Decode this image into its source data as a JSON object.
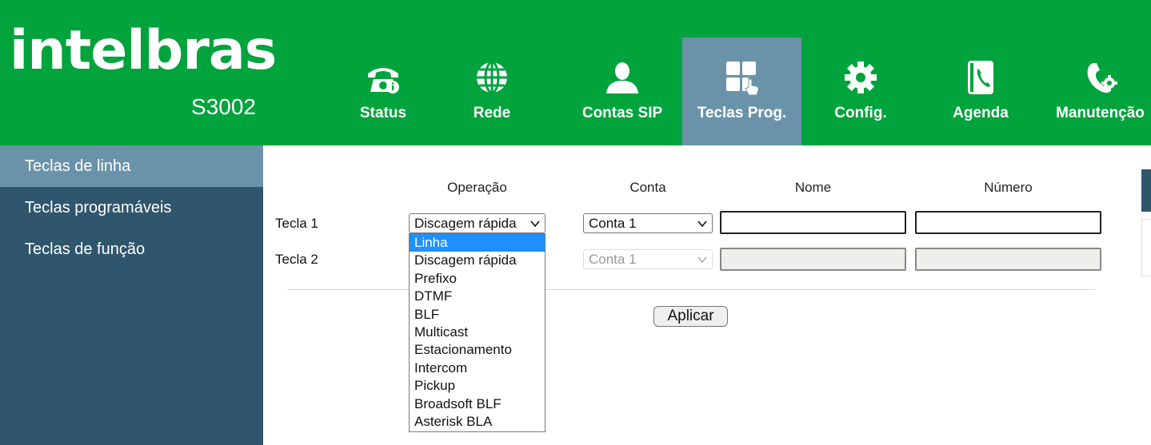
{
  "brand": {
    "logo_text": "intelbras",
    "model": "S3002"
  },
  "colors": {
    "header_green": "#00a33c",
    "active_tab": "#6a93a9",
    "sidebar": "#2f566c",
    "dropdown_highlight": "#1e90ff"
  },
  "nav": {
    "tabs": [
      {
        "label": "Status",
        "icon": "phone-info-icon",
        "active": false
      },
      {
        "label": "Rede",
        "icon": "globe-icon",
        "active": false
      },
      {
        "label": "Contas SIP",
        "icon": "user-icon",
        "active": false
      },
      {
        "label": "Teclas Prog.",
        "icon": "keypad-icon",
        "active": true
      },
      {
        "label": "Config.",
        "icon": "gear-icon",
        "active": false
      },
      {
        "label": "Agenda",
        "icon": "phonebook-icon",
        "active": false
      },
      {
        "label": "Manutenção",
        "icon": "phone-gear-icon",
        "active": false
      }
    ]
  },
  "sidebar": {
    "items": [
      {
        "label": "Teclas de linha",
        "active": true
      },
      {
        "label": "Teclas programáveis",
        "active": false
      },
      {
        "label": "Teclas de função",
        "active": false
      }
    ]
  },
  "table": {
    "headers": {
      "operacao": "Operação",
      "conta": "Conta",
      "nome": "Nome",
      "numero": "Número"
    },
    "rows": [
      {
        "label": "Tecla 1",
        "operacao": "Discagem rápida",
        "conta": "Conta 1",
        "nome": "",
        "numero": "",
        "disabled": false
      },
      {
        "label": "Tecla 2",
        "operacao": "",
        "conta": "Conta 1",
        "nome": "",
        "numero": "",
        "disabled": true
      }
    ]
  },
  "apply_label": "Aplicar",
  "dropdown": {
    "highlighted": "Linha",
    "options": [
      "Linha",
      "Discagem rápida",
      "Prefixo",
      "DTMF",
      "BLF",
      "Multicast",
      "Estacionamento",
      "Intercom",
      "Pickup",
      "Broadsoft BLF",
      "Asterisk BLA"
    ]
  }
}
